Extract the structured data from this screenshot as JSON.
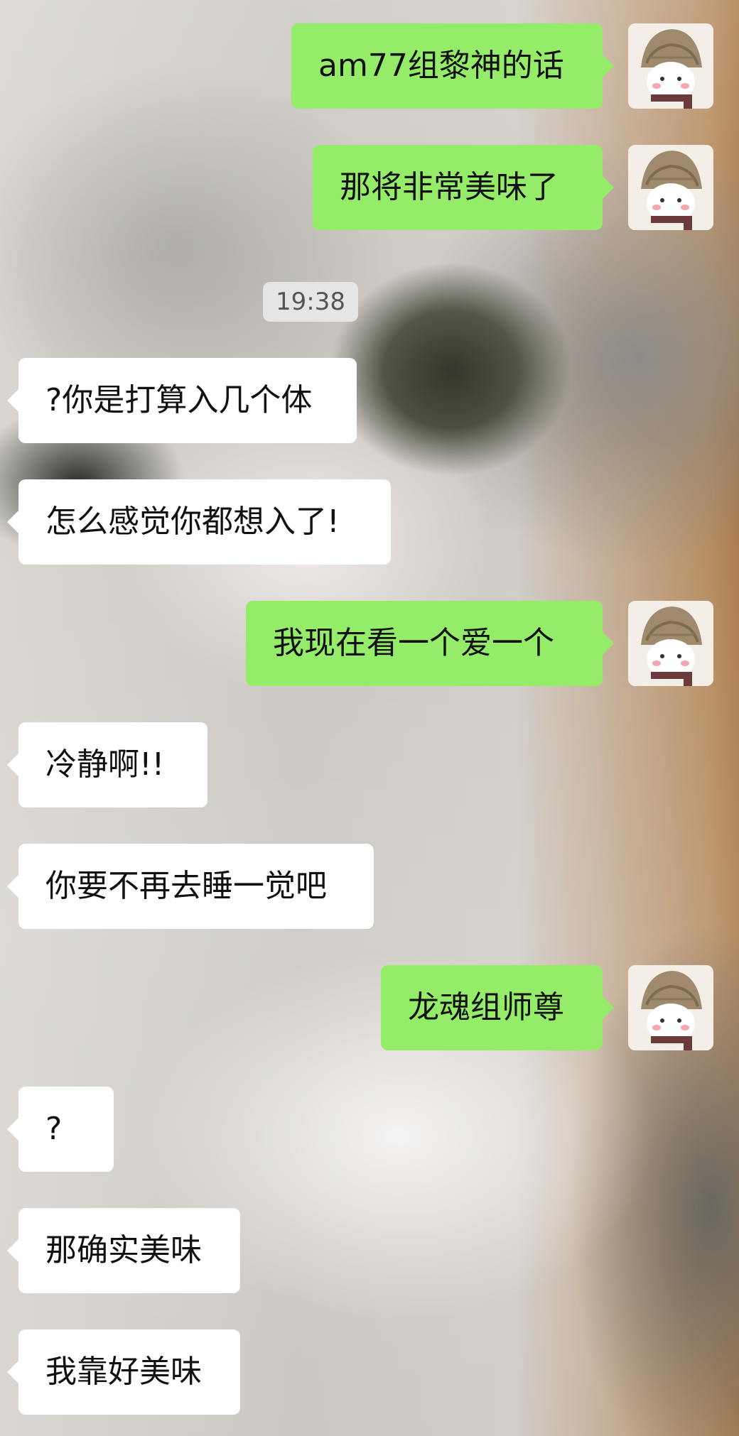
{
  "timestamp": "19:38",
  "messages": [
    {
      "from": "me",
      "text": "am77组黎神的话"
    },
    {
      "from": "me",
      "text": "那将非常美味了"
    },
    {
      "from": "other",
      "text": "?你是打算入几个体"
    },
    {
      "from": "other",
      "text": "怎么感觉你都想入了!"
    },
    {
      "from": "me",
      "text": "我现在看一个爱一个"
    },
    {
      "from": "other",
      "text": "冷静啊!!"
    },
    {
      "from": "other",
      "text": "你要不再去睡一觉吧"
    },
    {
      "from": "me",
      "text": "龙魂组师尊"
    },
    {
      "from": "other",
      "text": "?"
    },
    {
      "from": "other",
      "text": "那确实美味"
    },
    {
      "from": "other",
      "text": "我靠好美味"
    }
  ]
}
